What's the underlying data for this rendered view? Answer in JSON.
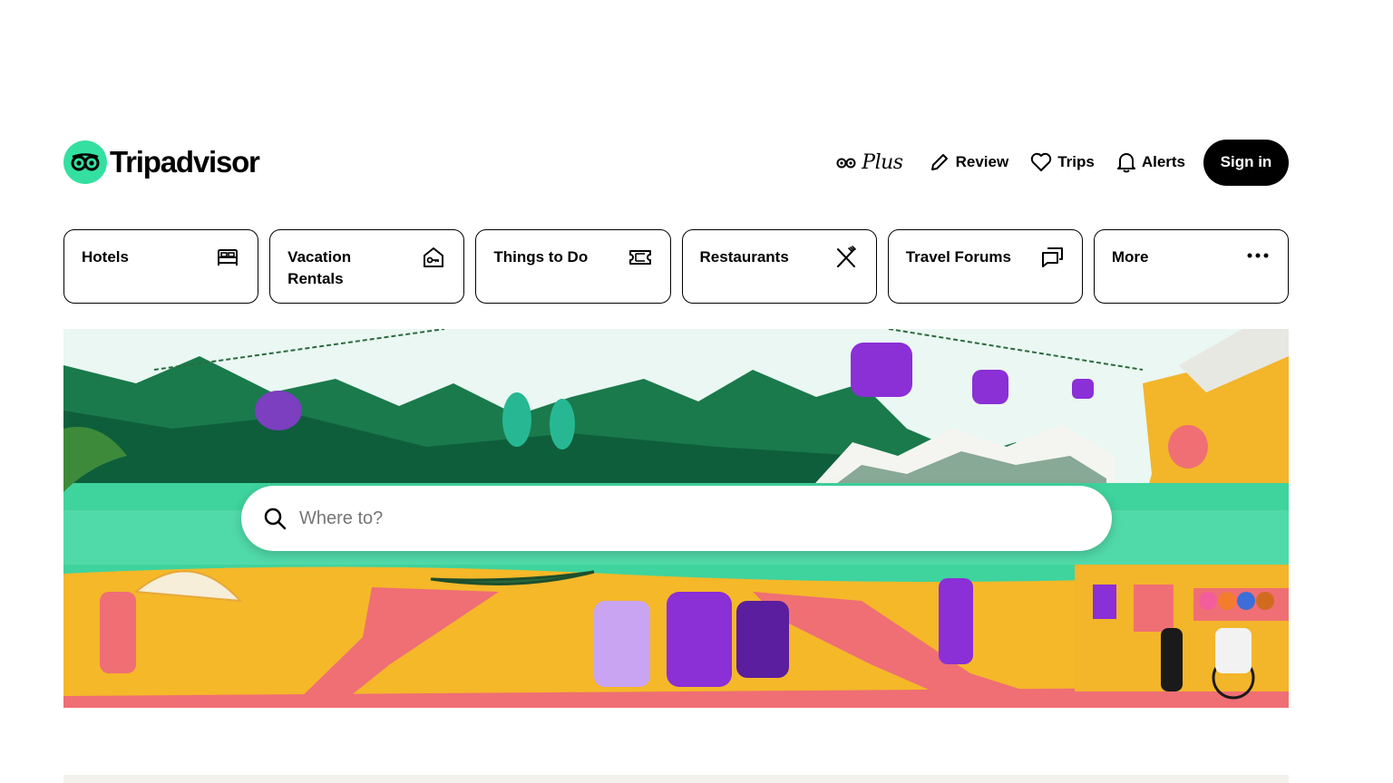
{
  "brand": {
    "name": "Tripadvisor",
    "logo_icon": "owl-eyes-icon",
    "accent_color": "#34e0a1"
  },
  "nav": {
    "plus_label": "Plus",
    "review_label": "Review",
    "trips_label": "Trips",
    "alerts_label": "Alerts",
    "signin_label": "Sign in"
  },
  "categories": [
    {
      "label": "Hotels",
      "icon": "bed-icon"
    },
    {
      "label": "Vacation Rentals",
      "icon": "house-key-icon"
    },
    {
      "label": "Things to Do",
      "icon": "ticket-icon"
    },
    {
      "label": "Restaurants",
      "icon": "fork-knife-icon"
    },
    {
      "label": "Travel Forums",
      "icon": "chat-bubbles-icon"
    },
    {
      "label": "More",
      "icon": "more-dots-icon"
    }
  ],
  "search": {
    "placeholder": "Where to?",
    "icon": "search-icon"
  },
  "colors": {
    "primary_text": "#000000",
    "signin_bg": "#000000",
    "signin_text": "#ffffff"
  }
}
